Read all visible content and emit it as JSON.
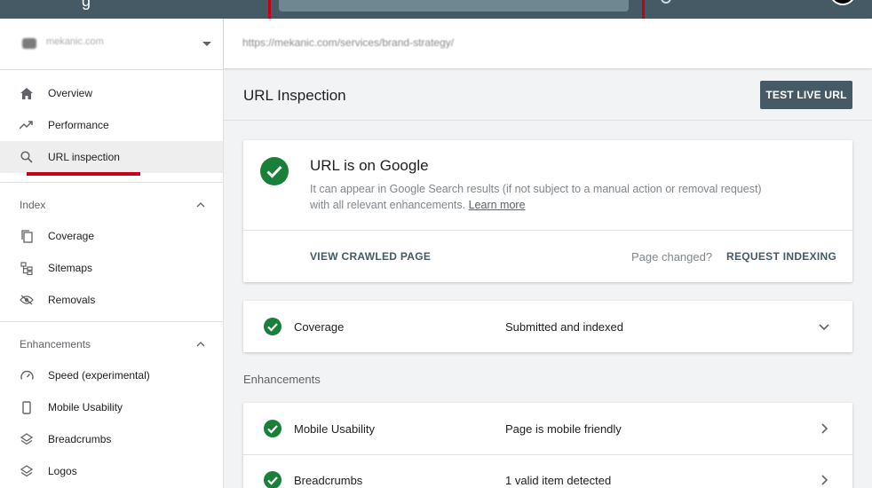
{
  "topbar": {
    "brand_partial": "g",
    "search_placeholder": ""
  },
  "sidebar": {
    "property_name": "mekanic.com",
    "items": [
      {
        "label": "Overview",
        "icon": "home-icon"
      },
      {
        "label": "Performance",
        "icon": "trending-up-icon"
      },
      {
        "label": "URL inspection",
        "icon": "search-icon",
        "active": true
      }
    ],
    "index_section": {
      "label": "Index",
      "items": [
        {
          "label": "Coverage",
          "icon": "coverage-icon"
        },
        {
          "label": "Sitemaps",
          "icon": "sitemap-icon"
        },
        {
          "label": "Removals",
          "icon": "eye-off-icon"
        }
      ]
    },
    "enhancements_section": {
      "label": "Enhancements",
      "items": [
        {
          "label": "Speed (experimental)",
          "icon": "speedometer-icon"
        },
        {
          "label": "Mobile Usability",
          "icon": "phone-icon"
        },
        {
          "label": "Breadcrumbs",
          "icon": "layers-icon"
        },
        {
          "label": "Logos",
          "icon": "layers-icon"
        }
      ]
    }
  },
  "urlbar": {
    "url": "https://mekanic.com/services/brand-strategy/"
  },
  "main": {
    "title": "URL Inspection",
    "test_live_url": "TEST LIVE URL",
    "status": {
      "headline": "URL is on Google",
      "description": "It can appear in Google Search results (if not subject to a manual action or removal request) with all relevant enhancements.",
      "learn_more": "Learn more",
      "view_crawled": "VIEW CRAWLED PAGE",
      "page_changed": "Page changed?",
      "request_indexing": "REQUEST INDEXING"
    },
    "coverage": {
      "name": "Coverage",
      "value": "Submitted and indexed"
    },
    "enhancements_label": "Enhancements",
    "enhancements": [
      {
        "name": "Mobile Usability",
        "value": "Page is mobile friendly"
      },
      {
        "name": "Breadcrumbs",
        "value": "1 valid item detected"
      }
    ]
  },
  "colors": {
    "header": "#455a64",
    "highlight_red": "#c5001a",
    "success_green": "#188038"
  }
}
